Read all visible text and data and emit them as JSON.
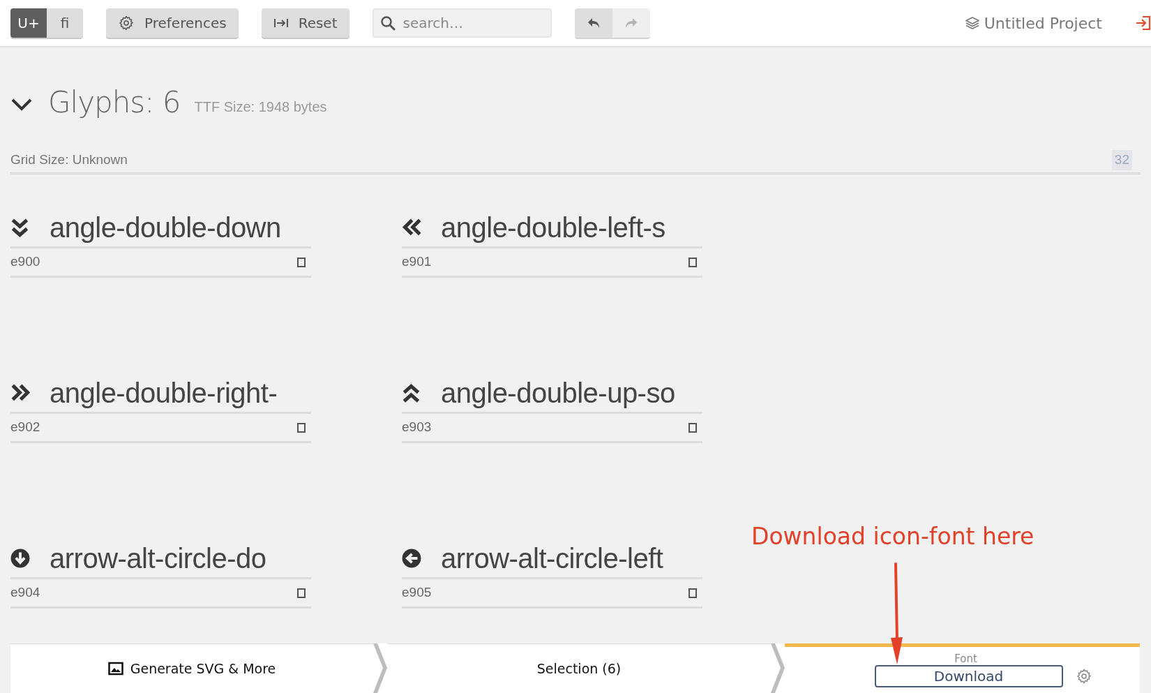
{
  "toolbar": {
    "mode_toggle": [
      {
        "label": "U+",
        "selected": true
      },
      {
        "label": "ﬁ",
        "selected": false
      }
    ],
    "buttons": [
      {
        "kind": "preferences",
        "label": "Preferences"
      },
      {
        "kind": "reset",
        "label": "Reset"
      }
    ],
    "search": {
      "placeholder": "search…"
    },
    "history": [
      {
        "kind": "undo",
        "disabled": false
      },
      {
        "kind": "redo",
        "disabled": true
      }
    ],
    "project": "Untitled Project"
  },
  "glyph_set": {
    "expanded": true,
    "title": "Glyphs: 6",
    "ttf_size": "TTF Size: 1948 bytes",
    "grid_size": "Grid Size: Unknown",
    "grid_value": "32"
  },
  "glyphs": [
    {
      "name": "angle-double-down",
      "code": "e900",
      "checked": false
    },
    {
      "name": "angle-double-left-s",
      "code": "e901",
      "checked": false
    },
    {
      "name": "angle-double-right-",
      "code": "e902",
      "checked": false
    },
    {
      "name": "angle-double-up-so",
      "code": "e903",
      "checked": false
    },
    {
      "name": "arrow-alt-circle-do",
      "code": "e904",
      "checked": false
    },
    {
      "name": "arrow-alt-circle-left",
      "code": "e905",
      "checked": false
    }
  ],
  "bottom_bar": [
    {
      "kind": "generate",
      "label": "Generate SVG & More",
      "selected": false
    },
    {
      "kind": "selection",
      "label": "Selection (6)",
      "selected": false
    },
    {
      "kind": "font",
      "label": "Font",
      "button": "Download",
      "selected": true
    }
  ],
  "annotation": {
    "text": "Download icon-font here"
  }
}
